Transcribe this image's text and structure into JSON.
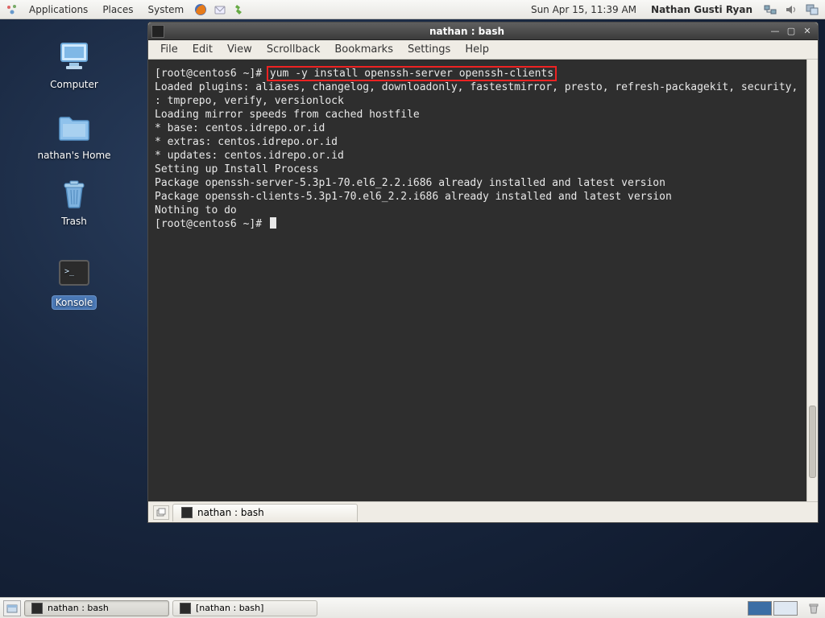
{
  "panel": {
    "menus": [
      "Applications",
      "Places",
      "System"
    ],
    "clock": "Sun Apr 15, 11:39 AM",
    "user": "Nathan Gusti Ryan"
  },
  "desktop_icons": {
    "computer": "Computer",
    "home": "nathan's Home",
    "trash": "Trash",
    "konsole": "Konsole"
  },
  "window": {
    "title": "nathan : bash",
    "menus": [
      "File",
      "Edit",
      "View",
      "Scrollback",
      "Bookmarks",
      "Settings",
      "Help"
    ],
    "tab_label": "nathan : bash"
  },
  "terminal": {
    "prompt": "[root@centos6 ~]# ",
    "highlighted_cmd": "yum -y install openssh-server openssh-clients",
    "lines": [
      "Loaded plugins: aliases, changelog, downloadonly, fastestmirror, presto, refresh-packagekit, security,",
      "              : tmprepo, verify, versionlock",
      "Loading mirror speeds from cached hostfile",
      " * base: centos.idrepo.or.id",
      " * extras: centos.idrepo.or.id",
      " * updates: centos.idrepo.or.id",
      "Setting up Install Process",
      "Package openssh-server-5.3p1-70.el6_2.2.i686 already installed and latest version",
      "Package openssh-clients-5.3p1-70.el6_2.2.i686 already installed and latest version",
      "Nothing to do"
    ],
    "prompt2": "[root@centos6 ~]# "
  },
  "taskbar": {
    "tasks": [
      "nathan : bash",
      "[nathan : bash]"
    ]
  }
}
